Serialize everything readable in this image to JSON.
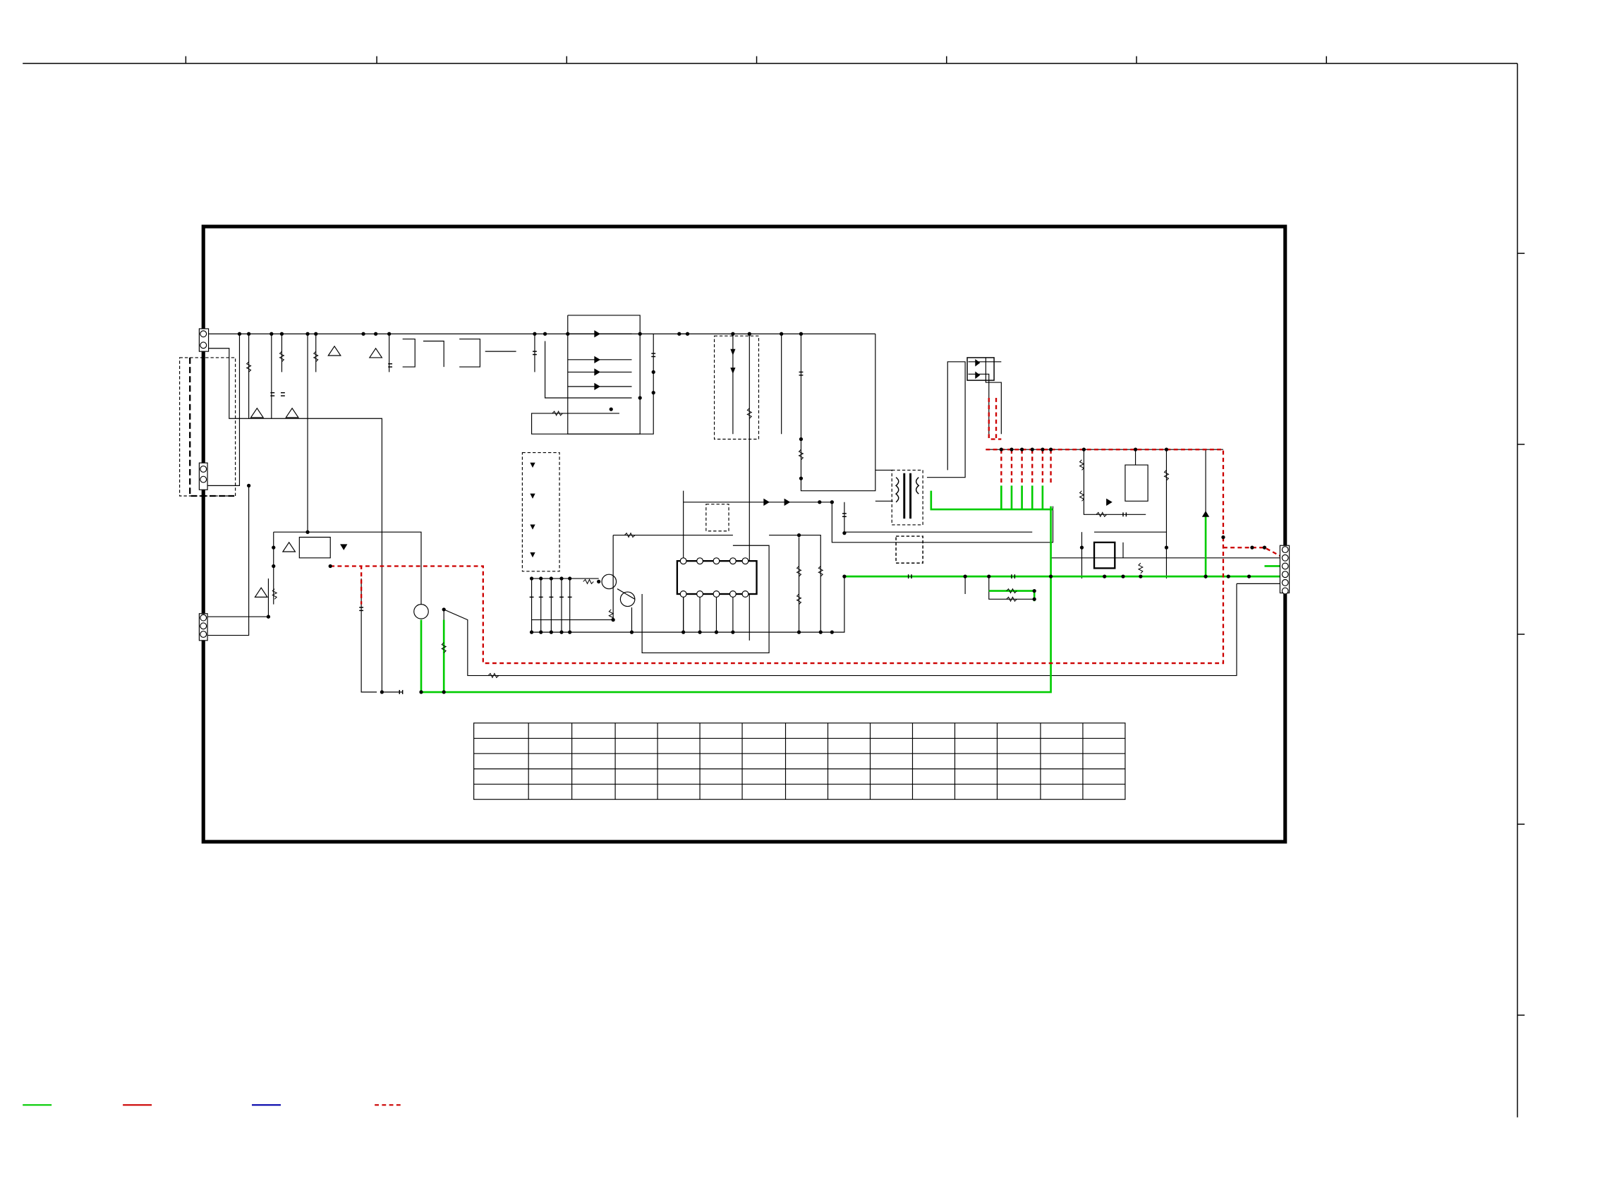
{
  "schematic": {
    "colors": {
      "line": "#000000",
      "green_wire": "#00cc00",
      "red_wire": "#cc0000",
      "blue_wire": "#0000aa",
      "background": "#ffffff"
    },
    "table": {
      "rows": 5,
      "cols": 16
    },
    "legend": [
      {
        "style": "solid",
        "color": "#00cc00"
      },
      {
        "style": "solid",
        "color": "#cc0000"
      },
      {
        "style": "solid",
        "color": "#0000aa"
      },
      {
        "style": "dashed",
        "color": "#cc0000"
      }
    ],
    "warning_symbol": "⚠"
  }
}
